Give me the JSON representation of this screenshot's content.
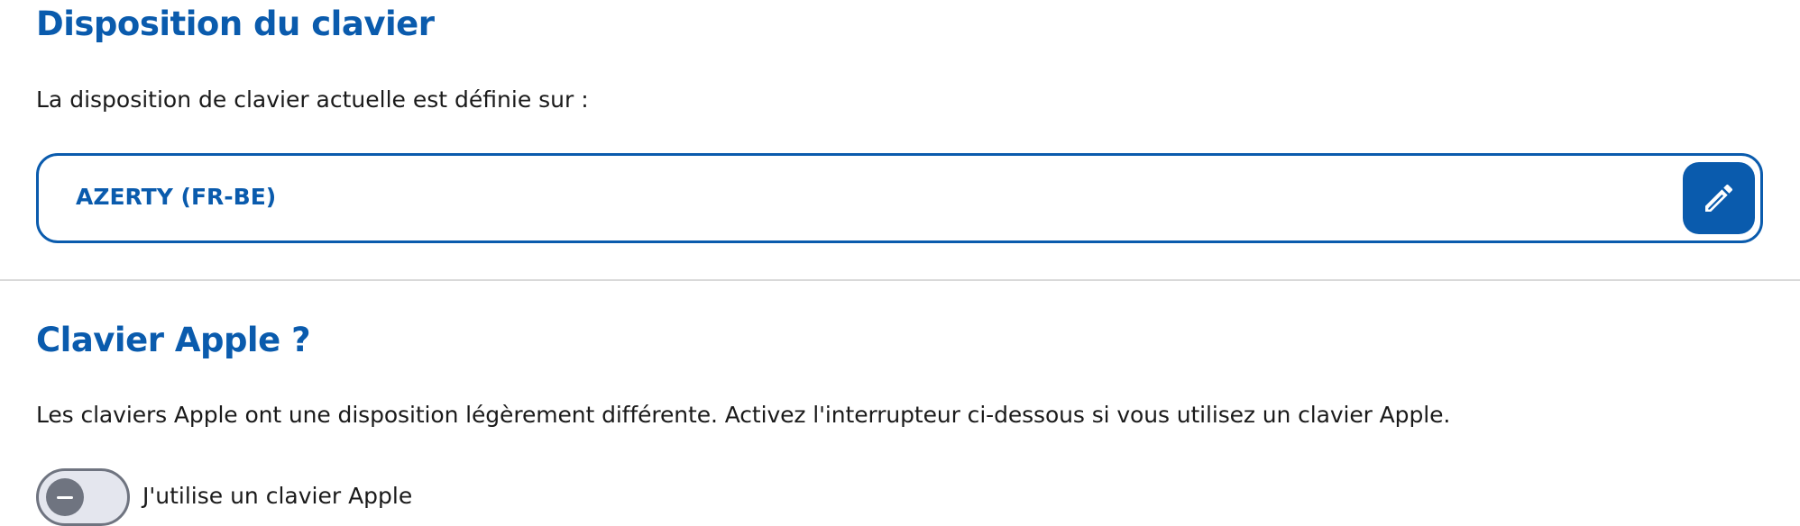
{
  "keyboard_layout": {
    "title": "Disposition du clavier",
    "description": "La disposition de clavier actuelle est définie sur :",
    "current_value": "AZERTY (FR-BE)",
    "edit_icon": "pencil-icon"
  },
  "apple_keyboard": {
    "title": "Clavier Apple ?",
    "description": "Les claviers Apple ont une disposition légèrement différente. Activez l'interrupteur ci-dessous si vous utilisez un clavier Apple.",
    "toggle_label": "J'utilise un clavier Apple",
    "toggle_on": false,
    "toggle_icon": "minus-icon"
  },
  "colors": {
    "accent": "#0a5bad",
    "toggle_off": "#6f7480",
    "toggle_track": "#e4e6ee",
    "divider": "#d9d9d9"
  }
}
